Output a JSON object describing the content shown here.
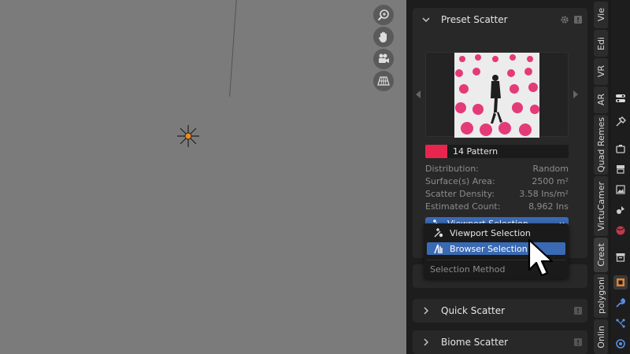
{
  "panel": {
    "preset_scatter": {
      "title": "Preset Scatter",
      "pattern_name": "14 Pattern",
      "pattern_color": "#e8254f",
      "stats": [
        {
          "label": "Distribution:",
          "value": "Random"
        },
        {
          "label": "Surface(s) Area:",
          "value": "2500 m²"
        },
        {
          "label": "Scatter Density:",
          "value": "3.58 Ins/m²"
        },
        {
          "label": "Estimated Count:",
          "value": "8,962 Ins"
        }
      ],
      "method_selected": "Viewport Selection"
    },
    "dropdown": {
      "items": [
        {
          "label": "Viewport Selection",
          "icon": "viewport-selection-icon"
        },
        {
          "label": "Browser Selection",
          "icon": "browser-selection-icon"
        }
      ],
      "footer": "Selection Method",
      "highlighted": 1
    },
    "quick_scatter": {
      "title": "Quick Scatter"
    },
    "biome_scatter": {
      "title": "Biome Scatter"
    }
  },
  "side_tabs": [
    "Vie",
    "Edi",
    "VR",
    "AR",
    "Quad Remes",
    "VirtuCamer",
    "Creat",
    "polygoni",
    "Onlin"
  ],
  "accent_color": "#3a6ab4"
}
